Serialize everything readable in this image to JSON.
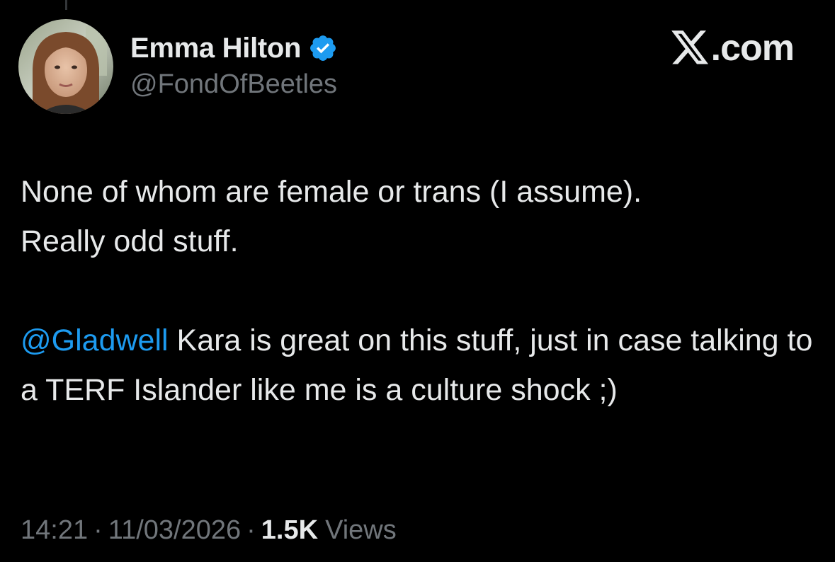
{
  "author": {
    "display_name": "Emma Hilton",
    "handle": "@FondOfBeetles",
    "verified": true,
    "verified_color": "#1d9bf0"
  },
  "brand": {
    "icon": "x-logo-icon",
    "text": ".com"
  },
  "tweet": {
    "line1": "None of whom are female or trans (I assume).\nReally odd stuff.",
    "mention": "@Gladwell",
    "line2": " Kara is great on this stuff, just in case talking to a TERF Islander like me is a culture shock ;)"
  },
  "meta": {
    "time": "14:21",
    "separator": "·",
    "date": "11/03/2026",
    "views_count": "1.5K",
    "views_label": "Views"
  },
  "colors": {
    "background": "#000000",
    "text": "#e7e9ea",
    "secondary": "#71767b",
    "link": "#1d9bf0"
  }
}
